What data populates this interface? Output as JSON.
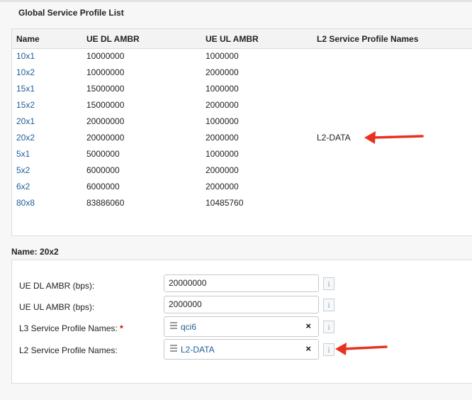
{
  "list": {
    "title": "Global Service Profile List",
    "columns": [
      "Name",
      "UE DL AMBR",
      "UE UL AMBR",
      "L2 Service Profile Names"
    ],
    "rows": [
      {
        "name": "10x1",
        "dl": "10000000",
        "ul": "1000000",
        "l2": ""
      },
      {
        "name": "10x2",
        "dl": "10000000",
        "ul": "2000000",
        "l2": ""
      },
      {
        "name": "15x1",
        "dl": "15000000",
        "ul": "1000000",
        "l2": ""
      },
      {
        "name": "15x2",
        "dl": "15000000",
        "ul": "2000000",
        "l2": ""
      },
      {
        "name": "20x1",
        "dl": "20000000",
        "ul": "1000000",
        "l2": ""
      },
      {
        "name": "20x2",
        "dl": "20000000",
        "ul": "2000000",
        "l2": "L2-DATA"
      },
      {
        "name": "5x1",
        "dl": "5000000",
        "ul": "1000000",
        "l2": ""
      },
      {
        "name": "5x2",
        "dl": "6000000",
        "ul": "2000000",
        "l2": ""
      },
      {
        "name": "6x2",
        "dl": "6000000",
        "ul": "2000000",
        "l2": ""
      },
      {
        "name": "80x8",
        "dl": "83886060",
        "ul": "10485760",
        "l2": ""
      }
    ]
  },
  "detail": {
    "title": "Name: 20x2",
    "fields": {
      "dl_label": "UE DL AMBR (bps):",
      "dl_value": "20000000",
      "ul_label": "UE UL AMBR (bps):",
      "ul_value": "2000000",
      "l3_label": "L3 Service Profile Names:",
      "required_mark": "*",
      "l3_tag": "qci6",
      "l2_label": "L2 Service Profile Names:",
      "l2_tag": "L2-DATA",
      "remove_glyph": "×",
      "info_glyph": "i"
    }
  },
  "icons": {
    "drag_handle": "drag-handle-icon",
    "remove": "close-icon",
    "info": "info-icon",
    "annotation": "red-arrow-icon"
  },
  "colors": {
    "link": "#1f5d9a",
    "annotation_arrow": "#e8321e",
    "required": "#cc0000"
  }
}
